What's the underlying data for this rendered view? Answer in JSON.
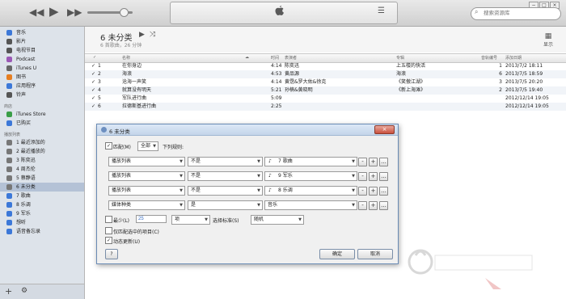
{
  "toolbar": {
    "prev_icon": "rewind-icon",
    "play_icon": "play-icon",
    "next_icon": "fast-forward-icon",
    "search_placeholder": "搜索资源库",
    "window_controls": [
      "−",
      "□",
      "×"
    ]
  },
  "sidebar": {
    "library": [
      {
        "label": "音乐",
        "icon": "music-note-icon",
        "color": "#3c78d8"
      },
      {
        "label": "影片",
        "icon": "film-icon",
        "color": "#555555"
      },
      {
        "label": "电视节目",
        "icon": "tv-icon",
        "color": "#555555"
      },
      {
        "label": "Podcast",
        "icon": "podcast-icon",
        "color": "#9b59b6"
      },
      {
        "label": "iTunes U",
        "icon": "graduation-cap-icon",
        "color": "#666666"
      },
      {
        "label": "图书",
        "icon": "book-icon",
        "color": "#e67e22"
      },
      {
        "label": "应用程序",
        "icon": "apps-icon",
        "color": "#3c78d8"
      },
      {
        "label": "铃声",
        "icon": "bell-icon",
        "color": "#555555"
      }
    ],
    "store_heading": "商店",
    "store": [
      {
        "label": "iTunes Store",
        "icon": "store-icon",
        "color": "#3a9e47"
      },
      {
        "label": "已购买",
        "icon": "purchased-icon",
        "color": "#3c78d8"
      }
    ],
    "playlists_heading": "播放列表",
    "playlists": [
      {
        "label": "1 最近添加的",
        "icon": "gear-icon",
        "color": "#777777"
      },
      {
        "label": "2 最近播放的",
        "icon": "gear-icon",
        "color": "#777777"
      },
      {
        "label": "3 陈奕迅",
        "icon": "gear-icon",
        "color": "#777777"
      },
      {
        "label": "4 周杰伦",
        "icon": "gear-icon",
        "color": "#777777"
      },
      {
        "label": "5 蔡静语",
        "icon": "gear-icon",
        "color": "#777777"
      },
      {
        "label": "6 未分类",
        "icon": "gear-icon",
        "color": "#777777",
        "selected": true
      },
      {
        "label": "7 歌曲",
        "icon": "playlist-icon",
        "color": "#3c78d8"
      },
      {
        "label": "8 乐调",
        "icon": "playlist-icon",
        "color": "#3c78d8"
      },
      {
        "label": "9 军乐",
        "icon": "playlist-icon",
        "color": "#3c78d8"
      },
      {
        "label": "想听",
        "icon": "playlist-icon",
        "color": "#3c78d8"
      },
      {
        "label": "语音备忘录",
        "icon": "playlist-icon",
        "color": "#3c78d8"
      }
    ]
  },
  "main": {
    "title": "6 未分类",
    "subtitle": "6 首歌曲，26 分钟",
    "edit_label": "显示",
    "columns": {
      "check": "",
      "name": "名称",
      "time": "时间",
      "artist": "表演者",
      "album": "专辑",
      "playcount": "音轨编号",
      "date": "添加日期"
    },
    "rows": [
      {
        "num": "1",
        "name": "在你身边",
        "time": "4:14",
        "artist": "陈奕迅",
        "album": "上五楼的快活",
        "track": "1",
        "date": "2013/7/2 18:11"
      },
      {
        "num": "2",
        "name": "海浪",
        "time": "4:53",
        "artist": "黄品源",
        "album": "海浪",
        "track": "6",
        "date": "2013/7/5 18:59"
      },
      {
        "num": "3",
        "name": "沧海一声笑",
        "time": "4:14",
        "artist": "黄霑&罗大佑&徐克",
        "album": "《笑傲江湖》",
        "track": "3",
        "date": "2013/7/5 20:20"
      },
      {
        "num": "4",
        "name": "就算没有明天",
        "time": "5:21",
        "artist": "孙楠&黄晓明",
        "album": "《新上海滩》",
        "track": "2",
        "date": "2013/7/5 19:40"
      },
      {
        "num": "5",
        "name": "军队进行曲",
        "time": "5:09",
        "artist": "",
        "album": "",
        "track": "",
        "date": "2012/12/14 19:05"
      },
      {
        "num": "6",
        "name": "拉德斯基进行曲",
        "time": "2:25",
        "artist": "",
        "album": "",
        "track": "",
        "date": "2012/12/14 19:05"
      }
    ]
  },
  "dialog": {
    "title": "6 未分类",
    "close": "×",
    "match_label": "匹配(M)",
    "match_value": "全部",
    "match_suffix": "下列规则:",
    "rules": [
      {
        "field": "播放列表",
        "op": "不是",
        "value": "7 歌曲",
        "icon": "playlist-icon"
      },
      {
        "field": "播放列表",
        "op": "不是",
        "value": "9 军乐",
        "icon": "playlist-icon"
      },
      {
        "field": "播放列表",
        "op": "不是",
        "value": "8 乐调",
        "icon": "playlist-icon"
      },
      {
        "field": "媒体种类",
        "op": "是",
        "value": "音乐",
        "icon": ""
      }
    ],
    "limit_label": "最少(L)",
    "limit_value": "25",
    "limit_unit": "项",
    "selected_by_label": "选择标准(S)",
    "selected_by_value": "随机",
    "only_checked_label": "仅匹配选中的项目(C)",
    "live_update_label": "动态更新(U)",
    "help": "?",
    "ok": "确定",
    "cancel": "取消",
    "btn_minus": "-",
    "btn_plus": "+",
    "btn_more": "..."
  }
}
